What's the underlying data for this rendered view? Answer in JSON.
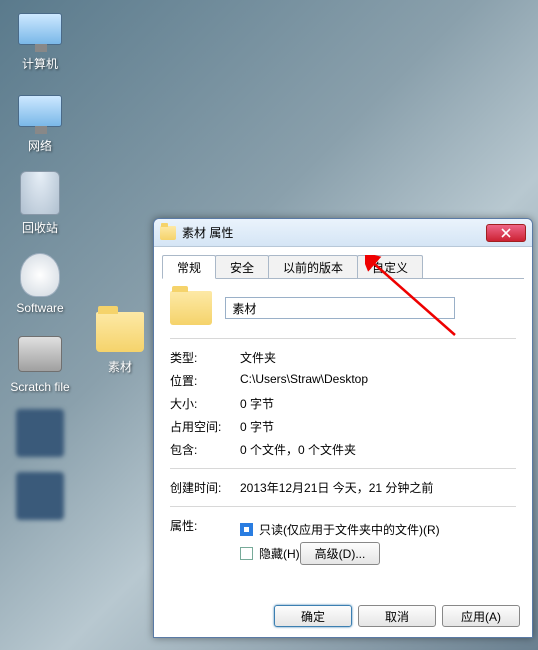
{
  "desktop": {
    "icons": [
      {
        "label": "计算机"
      },
      {
        "label": "网络"
      },
      {
        "label": "回收站"
      },
      {
        "label": "Software"
      },
      {
        "label": "Scratch file"
      }
    ],
    "col2": [
      {
        "label": "素材"
      }
    ]
  },
  "dialog": {
    "title": "素材 属性",
    "tabs": [
      "常规",
      "安全",
      "以前的版本",
      "自定义"
    ],
    "active_tab": 0,
    "name": "素材",
    "rows": {
      "type_label": "类型:",
      "type_value": "文件夹",
      "location_label": "位置:",
      "location_value": "C:\\Users\\Straw\\Desktop",
      "size_label": "大小:",
      "size_value": "0 字节",
      "ondisk_label": "占用空间:",
      "ondisk_value": "0 字节",
      "contains_label": "包含:",
      "contains_value": "0 个文件，0 个文件夹",
      "created_label": "创建时间:",
      "created_value": "2013年12月21日 今天，21 分钟之前",
      "attr_label": "属性:",
      "readonly_label": "只读(仅应用于文件夹中的文件)(R)",
      "hidden_label": "隐藏(H)",
      "advanced": "高级(D)..."
    },
    "buttons": {
      "ok": "确定",
      "cancel": "取消",
      "apply": "应用(A)"
    }
  }
}
